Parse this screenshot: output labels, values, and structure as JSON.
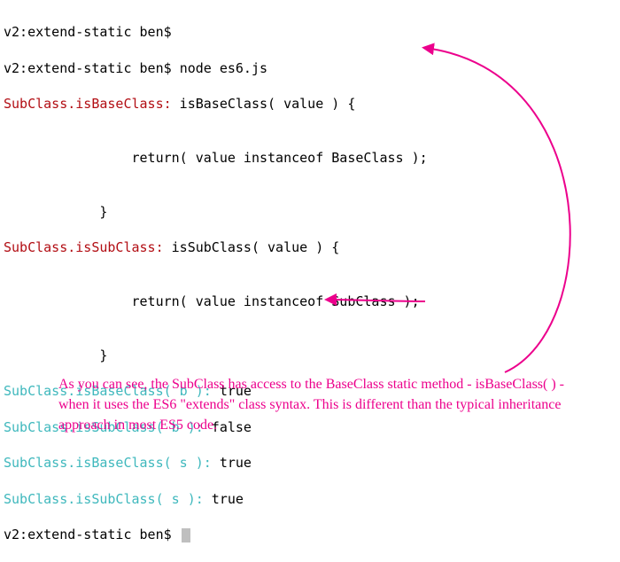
{
  "terminal": {
    "line01_prompt": "v2:extend-static ben$ ",
    "line02_prompt": "v2:extend-static ben$ ",
    "line02_cmd": "node es6.js",
    "line03_label": "SubClass.isBaseClass:",
    "line03_rest": " isBaseClass( value ) {",
    "line04": "",
    "line05": "                return( value instanceof BaseClass );",
    "line06": "",
    "line07": "            }",
    "line08_label": "SubClass.isSubClass:",
    "line08_rest": " isSubClass( value ) {",
    "line09": "",
    "line10": "                return( value instanceof SubClass );",
    "line11": "",
    "line12": "            }",
    "line13_label": "SubClass.isBaseClass( b ):",
    "line13_rest": " true",
    "line14_label": "SubClass.isSubClass( b ):",
    "line14_rest": " false",
    "line15_label": "SubClass.isBaseClass( s ):",
    "line15_rest": " true",
    "line16_label": "SubClass.isSubClass( s ):",
    "line16_rest": " true",
    "line17_prompt": "v2:extend-static ben$ "
  },
  "annotation": {
    "text": "As you can see, the SubClass has access to the BaseClass static method - isBaseClass( ) - when it uses the ES6 \"extends\" class syntax. This is different than the typical inheritance approach in most ES5 code."
  },
  "colors": {
    "red": "#b20d13",
    "cyan": "#3fb8bd",
    "pink": "#ec008c"
  }
}
